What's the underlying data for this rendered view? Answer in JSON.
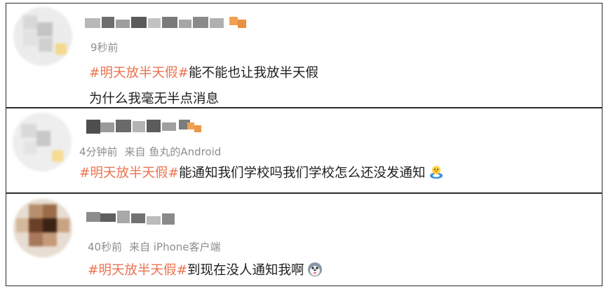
{
  "comments": [
    {
      "time": "9秒前",
      "source": "",
      "topic": "#明天放半天假#",
      "text": "能不能也让我放半天假",
      "text2": "为什么我毫无半点消息",
      "emoji": ""
    },
    {
      "time": "4分钟前",
      "source": "来自 鱼丸的Android",
      "topic": "#明天放半天假#",
      "text": "能通知我们学校吗我们学校怎么还没发通知",
      "emoji": "duck-swim-ring-emoji"
    },
    {
      "time": "40秒前",
      "source": "来自 iPhone客户端",
      "topic": "#明天放半天假#",
      "text": "到现在没人通知我啊",
      "emoji": "husky-tongue-emoji"
    }
  ],
  "colors": {
    "topic": "#eb7350",
    "meta": "#8e8e8e",
    "text": "#1e1e1e",
    "border": "#2a2a2a"
  }
}
